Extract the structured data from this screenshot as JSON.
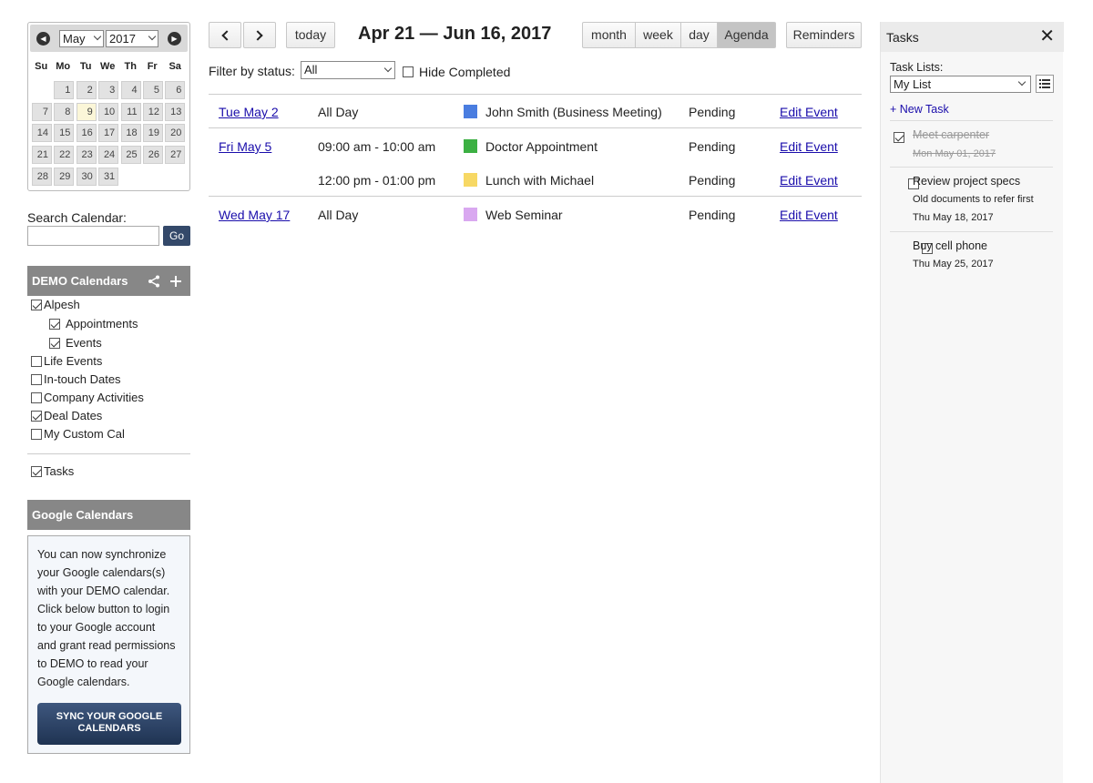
{
  "mini_calendar": {
    "month": "May",
    "year": "2017",
    "weekdays": [
      "Su",
      "Mo",
      "Tu",
      "We",
      "Th",
      "Fr",
      "Sa"
    ],
    "weeks": [
      [
        "",
        "1",
        "2",
        "3",
        "4",
        "5",
        "6"
      ],
      [
        "7",
        "8",
        "9",
        "10",
        "11",
        "12",
        "13"
      ],
      [
        "14",
        "15",
        "16",
        "17",
        "18",
        "19",
        "20"
      ],
      [
        "21",
        "22",
        "23",
        "24",
        "25",
        "26",
        "27"
      ],
      [
        "28",
        "29",
        "30",
        "31",
        "",
        "",
        ""
      ]
    ],
    "today": "9"
  },
  "search": {
    "label": "Search Calendar:",
    "value": "",
    "button": "Go"
  },
  "demo_calendars": {
    "header": "DEMO Calendars",
    "items": [
      {
        "label": "Alpesh",
        "checked": true
      },
      {
        "label": "Appointments",
        "checked": true
      },
      {
        "label": "Events",
        "checked": true
      },
      {
        "label": "Life Events",
        "checked": false
      },
      {
        "label": "In-touch Dates",
        "checked": false
      },
      {
        "label": "Company Activities",
        "checked": false
      },
      {
        "label": "Deal Dates",
        "checked": true
      },
      {
        "label": "My Custom Cal",
        "checked": false
      }
    ],
    "tasks": {
      "label": "Tasks",
      "checked": true
    }
  },
  "google": {
    "header": "Google Calendars",
    "lines": [
      "You can now synchronize",
      "your Google calendars(s)",
      "with your DEMO calendar.",
      "Click below button to login",
      "to your Google account",
      "and grant read permissions",
      "to DEMO to read your",
      "Google calendars."
    ],
    "button_line1": "SYNC YOUR GOOGLE",
    "button_line2": "CALENDARS"
  },
  "toolbar": {
    "today": "today",
    "date_range": "Apr 21 — Jun 16, 2017",
    "views": [
      "month",
      "week",
      "day",
      "Agenda"
    ],
    "active_view": "Agenda",
    "reminders": "Reminders"
  },
  "filter": {
    "label": "Filter by status:",
    "value": "All",
    "hide_completed": "Hide Completed"
  },
  "agenda": [
    {
      "date": "Tue May 2",
      "time": "All Day",
      "color": "#4a7de0",
      "title": "John Smith (Business Meeting)",
      "status": "Pending",
      "action": "Edit Event"
    },
    {
      "date": "Fri May 5",
      "time": "09:00 am - 10:00 am",
      "color": "#3cb043",
      "title": "Doctor Appointment",
      "status": "Pending",
      "action": "Edit Event"
    },
    {
      "date": "",
      "time": "12:00 pm - 01:00 pm",
      "color": "#f7d864",
      "title": "Lunch with Michael",
      "status": "Pending",
      "action": "Edit Event"
    },
    {
      "date": "Wed May 17",
      "time": "All Day",
      "color": "#d9a8f0",
      "title": "Web Seminar",
      "status": "Pending",
      "action": "Edit Event"
    }
  ],
  "tasks_panel": {
    "title": "Tasks",
    "lists_label": "Task Lists:",
    "list_value": "My List",
    "new_task": "+ New Task",
    "tasks": [
      {
        "title": "Meet carpenter",
        "note": "",
        "date": "Mon May 01, 2017",
        "done": true
      },
      {
        "title": "Review project specs",
        "note": "Old documents to refer first",
        "date": "Thu May 18, 2017",
        "done": false
      },
      {
        "title": "Buy cell phone",
        "note": "",
        "date": "Thu May 25, 2017",
        "done": false
      }
    ]
  }
}
